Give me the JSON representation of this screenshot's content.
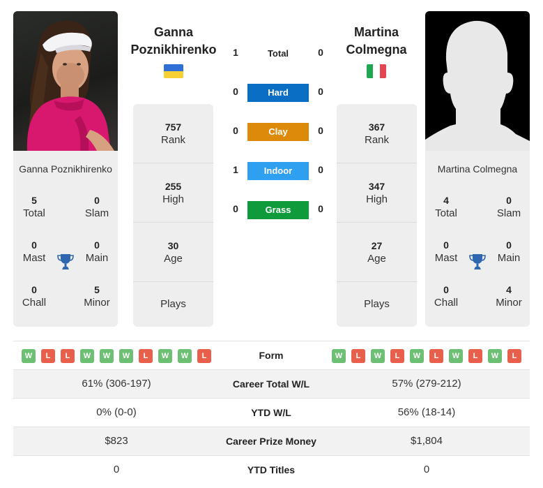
{
  "colors": {
    "hard": "#0a6ec4",
    "clay": "#dd8a0a",
    "indoor": "#2f9ff0",
    "grass": "#0f9a3c",
    "win": "#6dbf73",
    "loss": "#e8604c",
    "trophy": "#2f66b0"
  },
  "player1": {
    "name_line1": "Ganna",
    "name_line2": "Poznikhirenko",
    "full_name": "Ganna Poznikhirenko",
    "flag": "ukraine-flag",
    "photo": "player-photo",
    "titles": {
      "total": {
        "value": "5",
        "label": "Total"
      },
      "slam": {
        "value": "0",
        "label": "Slam"
      },
      "mast": {
        "value": "0",
        "label": "Mast"
      },
      "main": {
        "value": "0",
        "label": "Main"
      },
      "chall": {
        "value": "0",
        "label": "Chall"
      },
      "minor": {
        "value": "5",
        "label": "Minor"
      }
    },
    "stats": {
      "rank": {
        "value": "757",
        "label": "Rank"
      },
      "high": {
        "value": "255",
        "label": "High"
      },
      "age": {
        "value": "30",
        "label": "Age"
      },
      "plays": {
        "label": "Plays"
      }
    },
    "form": [
      "W",
      "L",
      "L",
      "W",
      "W",
      "W",
      "L",
      "W",
      "W",
      "L"
    ],
    "career_wl": "61% (306-197)",
    "ytd_wl": "0% (0-0)",
    "prize_money": "$823",
    "ytd_titles": "0"
  },
  "player2": {
    "name_line1": "Martina",
    "name_line2": "Colmegna",
    "full_name": "Martina Colmegna",
    "flag": "italy-flag",
    "photo": "silhouette-placeholder",
    "titles": {
      "total": {
        "value": "4",
        "label": "Total"
      },
      "slam": {
        "value": "0",
        "label": "Slam"
      },
      "mast": {
        "value": "0",
        "label": "Mast"
      },
      "main": {
        "value": "0",
        "label": "Main"
      },
      "chall": {
        "value": "0",
        "label": "Chall"
      },
      "minor": {
        "value": "4",
        "label": "Minor"
      }
    },
    "stats": {
      "rank": {
        "value": "367",
        "label": "Rank"
      },
      "high": {
        "value": "347",
        "label": "High"
      },
      "age": {
        "value": "27",
        "label": "Age"
      },
      "plays": {
        "label": "Plays"
      }
    },
    "form": [
      "W",
      "L",
      "W",
      "L",
      "W",
      "L",
      "W",
      "L",
      "W",
      "L"
    ],
    "career_wl": "57% (279-212)",
    "ytd_wl": "56% (18-14)",
    "prize_money": "$1,804",
    "ytd_titles": "0"
  },
  "h2h": {
    "total": {
      "label": "Total",
      "p1": "1",
      "p2": "0"
    },
    "hard": {
      "label": "Hard",
      "p1": "0",
      "p2": "0"
    },
    "clay": {
      "label": "Clay",
      "p1": "0",
      "p2": "0"
    },
    "indoor": {
      "label": "Indoor",
      "p1": "1",
      "p2": "0"
    },
    "grass": {
      "label": "Grass",
      "p1": "0",
      "p2": "0"
    }
  },
  "table": {
    "form_label": "Form",
    "career_wl_label": "Career Total W/L",
    "ytd_wl_label": "YTD W/L",
    "prize_label": "Career Prize Money",
    "ytd_titles_label": "YTD Titles"
  }
}
